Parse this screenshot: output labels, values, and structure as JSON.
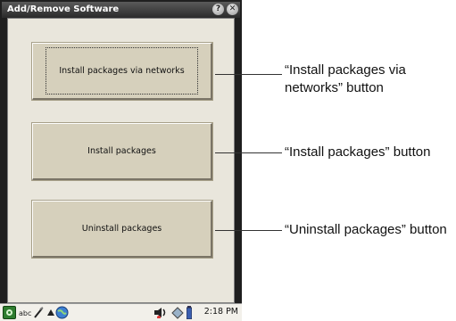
{
  "window": {
    "title": "Add/Remove Software",
    "help_label": "?",
    "close_label": "✕"
  },
  "buttons": {
    "network_install": "Install packages via networks",
    "install": "Install packages",
    "uninstall": "Uninstall packages"
  },
  "taskbar": {
    "keyboard_label": "abc",
    "clock": "2:18 PM"
  },
  "callouts": {
    "network_install": "“Install packages via networks” button",
    "install": "“Install packages” button",
    "uninstall": "“Uninstall packages” button"
  }
}
